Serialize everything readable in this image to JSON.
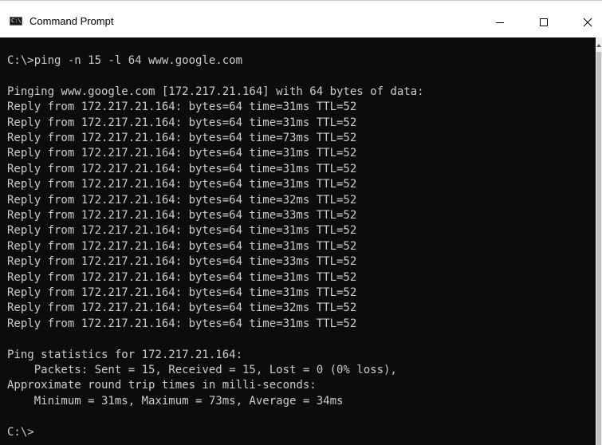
{
  "window": {
    "title": "Command Prompt",
    "icon_label": "C:\\",
    "controls": [
      "minimize-icon",
      "maximize-icon",
      "close-icon"
    ]
  },
  "console": {
    "lines": [
      "C:\\>ping -n 15 -l 64 www.google.com",
      "",
      "Pinging www.google.com [172.217.21.164] with 64 bytes of data:",
      "Reply from 172.217.21.164: bytes=64 time=31ms TTL=52",
      "Reply from 172.217.21.164: bytes=64 time=31ms TTL=52",
      "Reply from 172.217.21.164: bytes=64 time=73ms TTL=52",
      "Reply from 172.217.21.164: bytes=64 time=31ms TTL=52",
      "Reply from 172.217.21.164: bytes=64 time=31ms TTL=52",
      "Reply from 172.217.21.164: bytes=64 time=31ms TTL=52",
      "Reply from 172.217.21.164: bytes=64 time=32ms TTL=52",
      "Reply from 172.217.21.164: bytes=64 time=33ms TTL=52",
      "Reply from 172.217.21.164: bytes=64 time=31ms TTL=52",
      "Reply from 172.217.21.164: bytes=64 time=31ms TTL=52",
      "Reply from 172.217.21.164: bytes=64 time=33ms TTL=52",
      "Reply from 172.217.21.164: bytes=64 time=31ms TTL=52",
      "Reply from 172.217.21.164: bytes=64 time=31ms TTL=52",
      "Reply from 172.217.21.164: bytes=64 time=32ms TTL=52",
      "Reply from 172.217.21.164: bytes=64 time=31ms TTL=52",
      "",
      "Ping statistics for 172.217.21.164:",
      "    Packets: Sent = 15, Received = 15, Lost = 0 (0% loss),",
      "Approximate round trip times in milli-seconds:",
      "    Minimum = 31ms, Maximum = 73ms, Average = 34ms",
      "",
      "C:\\>"
    ]
  },
  "colors": {
    "console_background": "#0c0c0c",
    "console_text": "#cccccc",
    "titlebar_background": "#ffffff"
  }
}
